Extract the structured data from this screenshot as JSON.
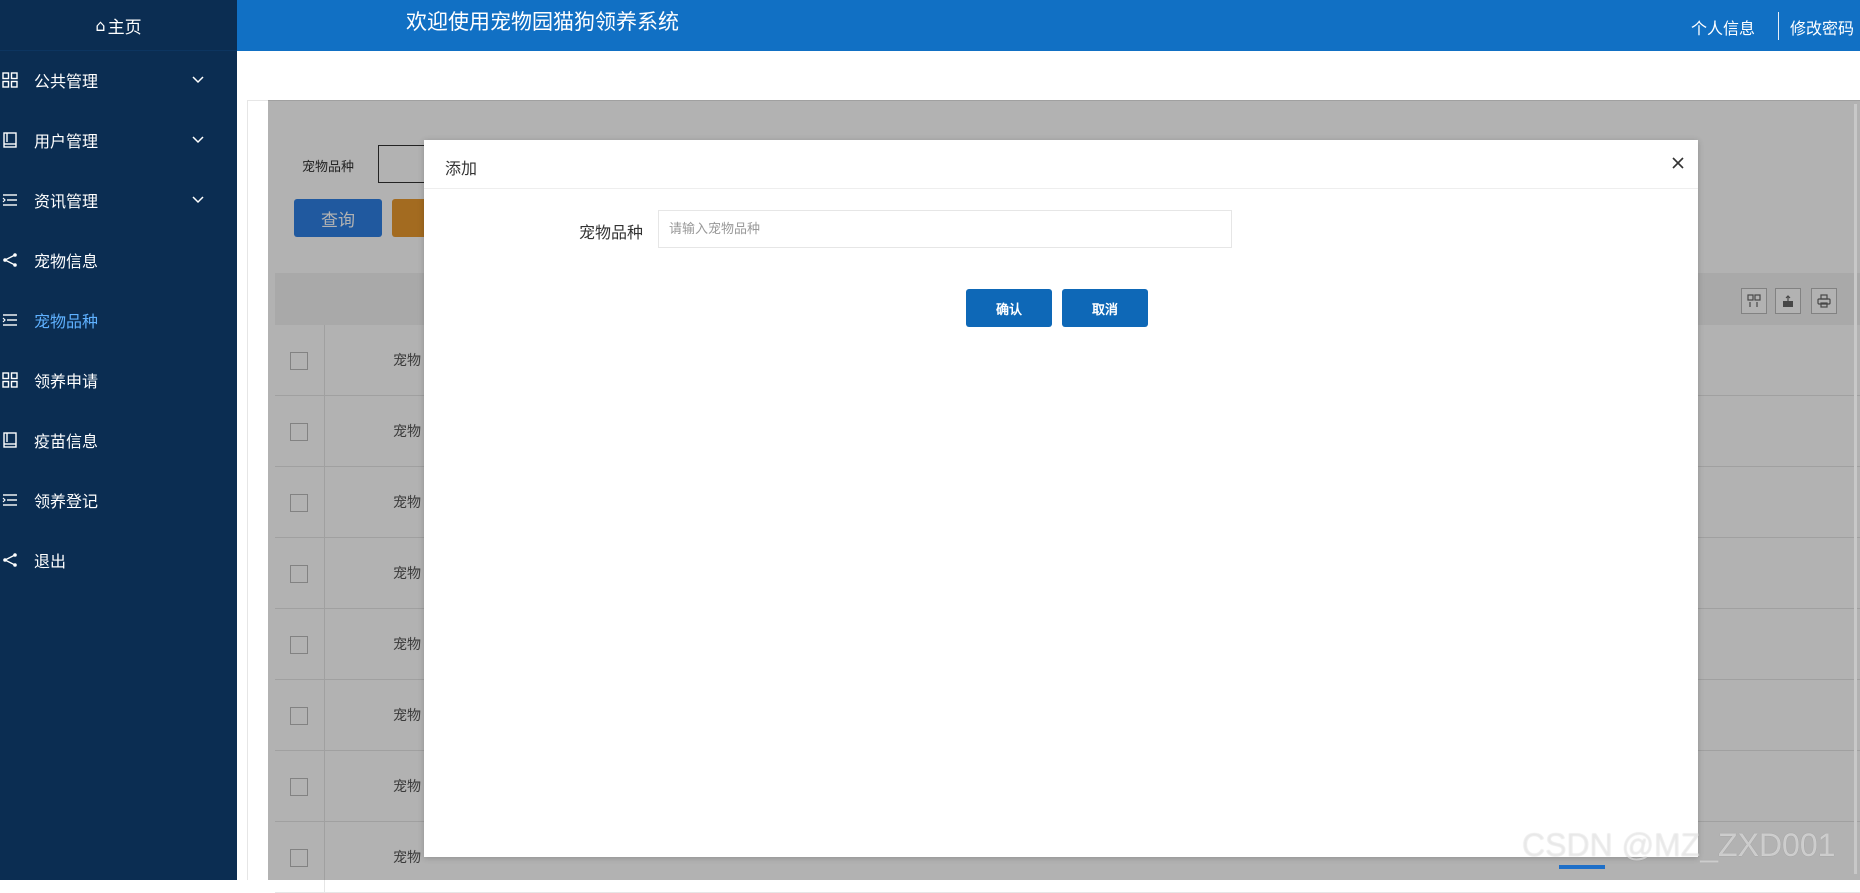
{
  "sidebar": {
    "home": "主页",
    "items": [
      {
        "label": "公共管理",
        "icon": "grid-icon",
        "expandable": true
      },
      {
        "label": "用户管理",
        "icon": "book-icon",
        "expandable": true
      },
      {
        "label": "资讯管理",
        "icon": "list-icon",
        "expandable": true
      },
      {
        "label": "宠物信息",
        "icon": "share-icon",
        "expandable": false
      },
      {
        "label": "宠物品种",
        "icon": "list-icon",
        "expandable": false,
        "active": true
      },
      {
        "label": "领养申请",
        "icon": "grid-icon",
        "expandable": false
      },
      {
        "label": "疫苗信息",
        "icon": "book-icon",
        "expandable": false
      },
      {
        "label": "领养登记",
        "icon": "list-icon",
        "expandable": false
      },
      {
        "label": "退出",
        "icon": "share-icon",
        "expandable": false
      }
    ]
  },
  "header": {
    "title": "欢迎使用宠物园猫狗领养系统",
    "profile": "个人信息",
    "change_password": "修改密码"
  },
  "search": {
    "label": "宠物品种",
    "query_button": "查询"
  },
  "table": {
    "header_cell": "宠物",
    "rows": [
      "宠物",
      "宠物",
      "宠物",
      "宠物",
      "宠物",
      "宠物",
      "宠物"
    ]
  },
  "modal": {
    "title": "添加",
    "field_label": "宠物品种",
    "field_placeholder": "请输入宠物品种",
    "field_value": "",
    "confirm": "确认",
    "cancel": "取消"
  },
  "watermark": "CSDN @MZ_ZXD001",
  "colors": {
    "sidebar_bg": "#0b2d52",
    "header_bg": "#1170c4",
    "primary_button": "#0e68b7",
    "active_menu_text": "#5fb1ff"
  }
}
